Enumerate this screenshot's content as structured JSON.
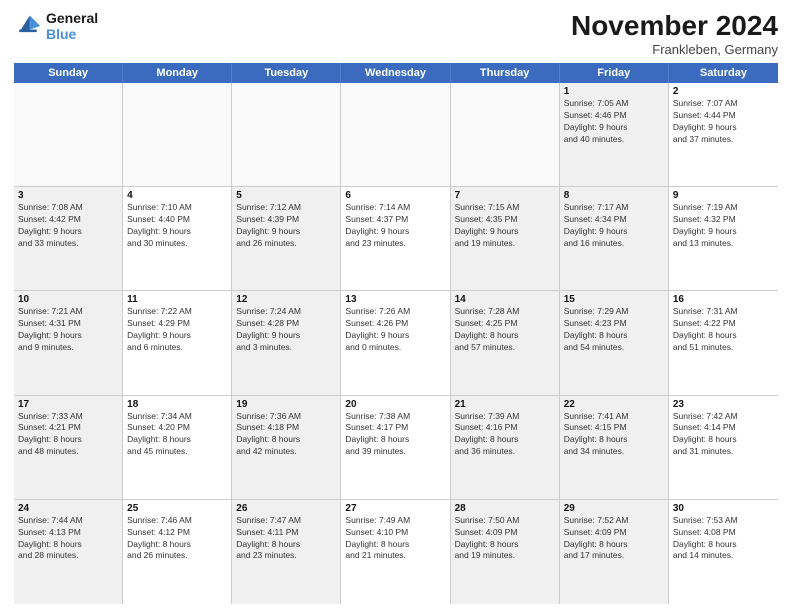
{
  "header": {
    "logo_line1": "General",
    "logo_line2": "Blue",
    "month": "November 2024",
    "location": "Frankleben, Germany"
  },
  "weekdays": [
    "Sunday",
    "Monday",
    "Tuesday",
    "Wednesday",
    "Thursday",
    "Friday",
    "Saturday"
  ],
  "rows": [
    [
      {
        "day": "",
        "info": "",
        "empty": true
      },
      {
        "day": "",
        "info": "",
        "empty": true
      },
      {
        "day": "",
        "info": "",
        "empty": true
      },
      {
        "day": "",
        "info": "",
        "empty": true
      },
      {
        "day": "",
        "info": "",
        "empty": true
      },
      {
        "day": "1",
        "info": "Sunrise: 7:05 AM\nSunset: 4:46 PM\nDaylight: 9 hours\nand 40 minutes.",
        "shaded": true
      },
      {
        "day": "2",
        "info": "Sunrise: 7:07 AM\nSunset: 4:44 PM\nDaylight: 9 hours\nand 37 minutes."
      }
    ],
    [
      {
        "day": "3",
        "info": "Sunrise: 7:08 AM\nSunset: 4:42 PM\nDaylight: 9 hours\nand 33 minutes.",
        "shaded": true
      },
      {
        "day": "4",
        "info": "Sunrise: 7:10 AM\nSunset: 4:40 PM\nDaylight: 9 hours\nand 30 minutes."
      },
      {
        "day": "5",
        "info": "Sunrise: 7:12 AM\nSunset: 4:39 PM\nDaylight: 9 hours\nand 26 minutes.",
        "shaded": true
      },
      {
        "day": "6",
        "info": "Sunrise: 7:14 AM\nSunset: 4:37 PM\nDaylight: 9 hours\nand 23 minutes."
      },
      {
        "day": "7",
        "info": "Sunrise: 7:15 AM\nSunset: 4:35 PM\nDaylight: 9 hours\nand 19 minutes.",
        "shaded": true
      },
      {
        "day": "8",
        "info": "Sunrise: 7:17 AM\nSunset: 4:34 PM\nDaylight: 9 hours\nand 16 minutes.",
        "shaded": true
      },
      {
        "day": "9",
        "info": "Sunrise: 7:19 AM\nSunset: 4:32 PM\nDaylight: 9 hours\nand 13 minutes."
      }
    ],
    [
      {
        "day": "10",
        "info": "Sunrise: 7:21 AM\nSunset: 4:31 PM\nDaylight: 9 hours\nand 9 minutes.",
        "shaded": true
      },
      {
        "day": "11",
        "info": "Sunrise: 7:22 AM\nSunset: 4:29 PM\nDaylight: 9 hours\nand 6 minutes."
      },
      {
        "day": "12",
        "info": "Sunrise: 7:24 AM\nSunset: 4:28 PM\nDaylight: 9 hours\nand 3 minutes.",
        "shaded": true
      },
      {
        "day": "13",
        "info": "Sunrise: 7:26 AM\nSunset: 4:26 PM\nDaylight: 9 hours\nand 0 minutes."
      },
      {
        "day": "14",
        "info": "Sunrise: 7:28 AM\nSunset: 4:25 PM\nDaylight: 8 hours\nand 57 minutes.",
        "shaded": true
      },
      {
        "day": "15",
        "info": "Sunrise: 7:29 AM\nSunset: 4:23 PM\nDaylight: 8 hours\nand 54 minutes.",
        "shaded": true
      },
      {
        "day": "16",
        "info": "Sunrise: 7:31 AM\nSunset: 4:22 PM\nDaylight: 8 hours\nand 51 minutes."
      }
    ],
    [
      {
        "day": "17",
        "info": "Sunrise: 7:33 AM\nSunset: 4:21 PM\nDaylight: 8 hours\nand 48 minutes.",
        "shaded": true
      },
      {
        "day": "18",
        "info": "Sunrise: 7:34 AM\nSunset: 4:20 PM\nDaylight: 8 hours\nand 45 minutes."
      },
      {
        "day": "19",
        "info": "Sunrise: 7:36 AM\nSunset: 4:18 PM\nDaylight: 8 hours\nand 42 minutes.",
        "shaded": true
      },
      {
        "day": "20",
        "info": "Sunrise: 7:38 AM\nSunset: 4:17 PM\nDaylight: 8 hours\nand 39 minutes."
      },
      {
        "day": "21",
        "info": "Sunrise: 7:39 AM\nSunset: 4:16 PM\nDaylight: 8 hours\nand 36 minutes.",
        "shaded": true
      },
      {
        "day": "22",
        "info": "Sunrise: 7:41 AM\nSunset: 4:15 PM\nDaylight: 8 hours\nand 34 minutes.",
        "shaded": true
      },
      {
        "day": "23",
        "info": "Sunrise: 7:42 AM\nSunset: 4:14 PM\nDaylight: 8 hours\nand 31 minutes."
      }
    ],
    [
      {
        "day": "24",
        "info": "Sunrise: 7:44 AM\nSunset: 4:13 PM\nDaylight: 8 hours\nand 28 minutes.",
        "shaded": true
      },
      {
        "day": "25",
        "info": "Sunrise: 7:46 AM\nSunset: 4:12 PM\nDaylight: 8 hours\nand 26 minutes."
      },
      {
        "day": "26",
        "info": "Sunrise: 7:47 AM\nSunset: 4:11 PM\nDaylight: 8 hours\nand 23 minutes.",
        "shaded": true
      },
      {
        "day": "27",
        "info": "Sunrise: 7:49 AM\nSunset: 4:10 PM\nDaylight: 8 hours\nand 21 minutes."
      },
      {
        "day": "28",
        "info": "Sunrise: 7:50 AM\nSunset: 4:09 PM\nDaylight: 8 hours\nand 19 minutes.",
        "shaded": true
      },
      {
        "day": "29",
        "info": "Sunrise: 7:52 AM\nSunset: 4:09 PM\nDaylight: 8 hours\nand 17 minutes.",
        "shaded": true
      },
      {
        "day": "30",
        "info": "Sunrise: 7:53 AM\nSunset: 4:08 PM\nDaylight: 8 hours\nand 14 minutes."
      }
    ]
  ]
}
